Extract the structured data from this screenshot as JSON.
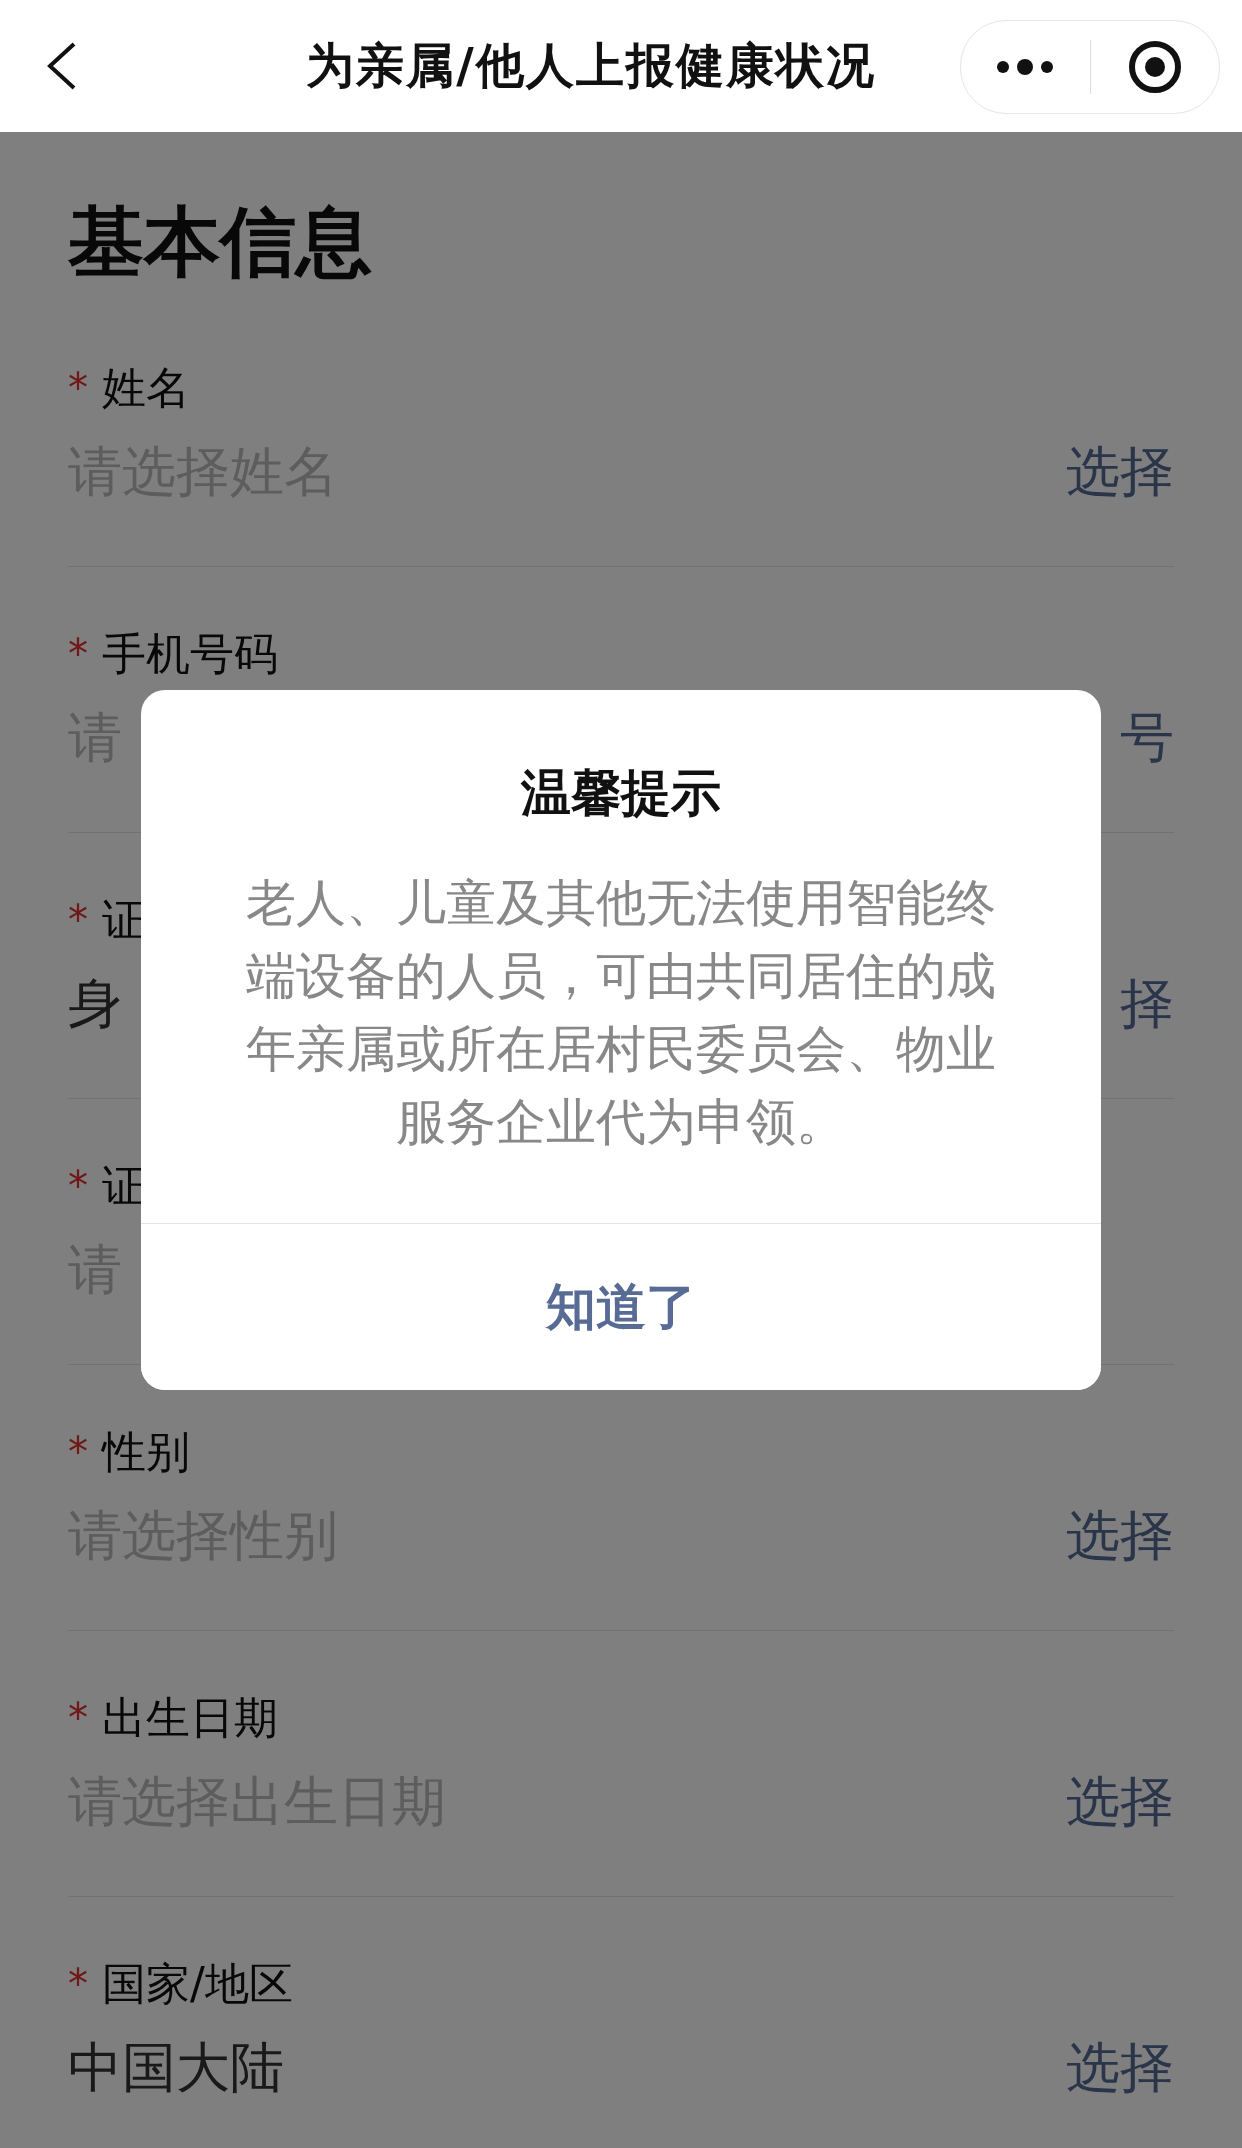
{
  "nav": {
    "title": "为亲属/他人上报健康状况"
  },
  "section_title": "基本信息",
  "fields": [
    {
      "mark": "*",
      "label": "姓名",
      "placeholder": "请选择姓名",
      "action": "选择"
    },
    {
      "mark": "*",
      "label": "手机号码",
      "placeholder": "请",
      "action": "号"
    },
    {
      "mark": "*",
      "label": "证",
      "value": "身",
      "action": "择"
    },
    {
      "mark": "*",
      "label": "证",
      "placeholder": "请"
    },
    {
      "mark": "*",
      "label": "性别",
      "placeholder": "请选择性别",
      "action": "选择"
    },
    {
      "mark": "*",
      "label": "出生日期",
      "placeholder": "请选择出生日期",
      "action": "选择"
    },
    {
      "mark": "*",
      "label": "国家/地区",
      "value": "中国大陆",
      "action": "选择"
    }
  ],
  "dialog": {
    "title": "温馨提示",
    "message": "老人、儿童及其他无法使用智能终端设备的人员，可由共同居住的成年亲属或所在居村民委员会、物业服务企业代为申领。",
    "button": "知道了"
  }
}
